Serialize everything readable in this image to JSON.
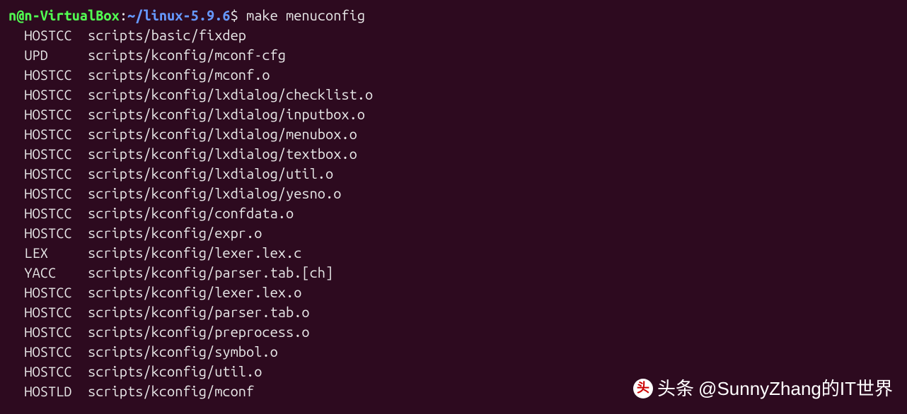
{
  "prompt": {
    "user": "n@n-VirtualBox",
    "separator": ":",
    "path": "~/linux-5.9.6",
    "symbol": "$"
  },
  "command": "make menuconfig",
  "output": [
    {
      "action": "HOSTCC",
      "file": "scripts/basic/fixdep"
    },
    {
      "action": "UPD",
      "file": "scripts/kconfig/mconf-cfg"
    },
    {
      "action": "HOSTCC",
      "file": "scripts/kconfig/mconf.o"
    },
    {
      "action": "HOSTCC",
      "file": "scripts/kconfig/lxdialog/checklist.o"
    },
    {
      "action": "HOSTCC",
      "file": "scripts/kconfig/lxdialog/inputbox.o"
    },
    {
      "action": "HOSTCC",
      "file": "scripts/kconfig/lxdialog/menubox.o"
    },
    {
      "action": "HOSTCC",
      "file": "scripts/kconfig/lxdialog/textbox.o"
    },
    {
      "action": "HOSTCC",
      "file": "scripts/kconfig/lxdialog/util.o"
    },
    {
      "action": "HOSTCC",
      "file": "scripts/kconfig/lxdialog/yesno.o"
    },
    {
      "action": "HOSTCC",
      "file": "scripts/kconfig/confdata.o"
    },
    {
      "action": "HOSTCC",
      "file": "scripts/kconfig/expr.o"
    },
    {
      "action": "LEX",
      "file": "scripts/kconfig/lexer.lex.c"
    },
    {
      "action": "YACC",
      "file": "scripts/kconfig/parser.tab.[ch]"
    },
    {
      "action": "HOSTCC",
      "file": "scripts/kconfig/lexer.lex.o"
    },
    {
      "action": "HOSTCC",
      "file": "scripts/kconfig/parser.tab.o"
    },
    {
      "action": "HOSTCC",
      "file": "scripts/kconfig/preprocess.o"
    },
    {
      "action": "HOSTCC",
      "file": "scripts/kconfig/symbol.o"
    },
    {
      "action": "HOSTCC",
      "file": "scripts/kconfig/util.o"
    },
    {
      "action": "HOSTLD",
      "file": "scripts/kconfig/mconf"
    }
  ],
  "watermark": {
    "prefix": "头条",
    "handle": "@SunnyZhang的IT世界"
  }
}
